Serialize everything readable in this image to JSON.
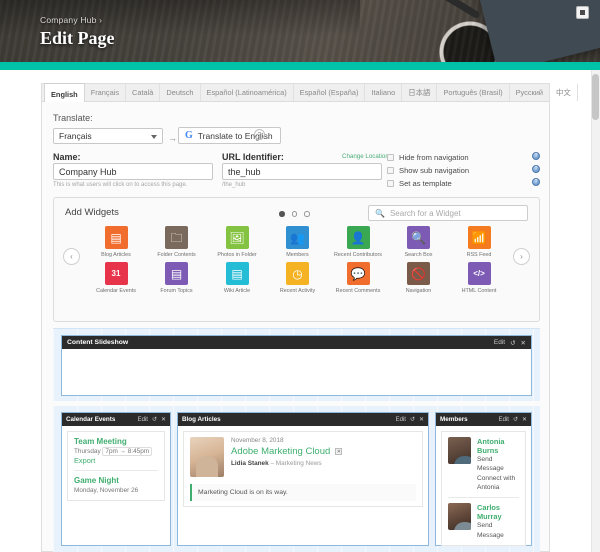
{
  "window": {
    "button_icon": "maximize-icon"
  },
  "hero": {
    "breadcrumb": "Company Hub ›",
    "title": "Edit Page",
    "accent_color": "#00c2a8"
  },
  "language_tabs": [
    {
      "label": "English",
      "active": true
    },
    {
      "label": "Français",
      "active": false
    },
    {
      "label": "Català",
      "active": false
    },
    {
      "label": "Deutsch",
      "active": false
    },
    {
      "label": "Español (Latinoamérica)",
      "active": false
    },
    {
      "label": "Español (España)",
      "active": false
    },
    {
      "label": "Italiano",
      "active": false
    },
    {
      "label": "日本語",
      "active": false
    },
    {
      "label": "Português (Brasil)",
      "active": false
    },
    {
      "label": "Русский",
      "active": false
    },
    {
      "label": "中文",
      "active": false
    }
  ],
  "translate": {
    "label": "Translate:",
    "selected_language": "Français",
    "arrow": "→",
    "button_label": "Translate to English",
    "google_glyph": "G",
    "help_glyph": "?"
  },
  "name_field": {
    "label": "Name:",
    "value": "Company Hub",
    "hint": "This is what users will click on to access this page."
  },
  "url_field": {
    "label": "URL Identifier:",
    "change_location": "Change Location",
    "value": "the_hub",
    "hint": "/the_hub"
  },
  "options": [
    {
      "label": "Hide from navigation",
      "checked": false
    },
    {
      "label": "Show sub navigation",
      "checked": false
    },
    {
      "label": "Set as template",
      "checked": false
    }
  ],
  "help_icons": [
    "?",
    "?",
    "?"
  ],
  "add_widgets": {
    "title": "Add Widgets",
    "search_placeholder": "Search for a Widget",
    "search_icon": "search-icon",
    "pages": [
      {
        "active": true
      },
      {
        "active": false
      },
      {
        "active": false
      }
    ],
    "prev_arrow": "‹",
    "next_arrow": "›",
    "rows": [
      [
        {
          "label": "Blog Articles",
          "color": "#f06d2e",
          "glyph": "▤"
        },
        {
          "label": "Folder Contents",
          "color": "#7a6a5d",
          "glyph": "🗀"
        },
        {
          "label": "Photos in Folder",
          "color": "#84c341",
          "glyph": "🖼"
        },
        {
          "label": "Members",
          "color": "#2f8fd1",
          "glyph": "👥"
        },
        {
          "label": "Recent Contributors",
          "color": "#3aa853",
          "glyph": "👤"
        },
        {
          "label": "Search Box",
          "color": "#7d5bb5",
          "glyph": "🔍"
        },
        {
          "label": "RSS Feed",
          "color": "#f47b20",
          "glyph": "📶"
        }
      ],
      [
        {
          "label": "Calendar Events",
          "color": "#e8344a",
          "glyph": "31"
        },
        {
          "label": "Forum Topics",
          "color": "#7d5bb5",
          "glyph": "▤"
        },
        {
          "label": "Wiki Article",
          "color": "#25bcd6",
          "glyph": "▤"
        },
        {
          "label": "Recent Activity",
          "color": "#f5b324",
          "glyph": "◷"
        },
        {
          "label": "Recent Comments",
          "color": "#f06d2e",
          "glyph": "💬"
        },
        {
          "label": "Navigation",
          "color": "#7a5a49",
          "glyph": "🚫"
        },
        {
          "label": "HTML Content",
          "color": "#7d5bb5",
          "glyph": "</>"
        }
      ]
    ]
  },
  "slideshow_panel": {
    "title": "Content Slideshow",
    "edit_label": "Edit",
    "revert_icon": "revert-icon",
    "close_icon": "close-icon"
  },
  "panel_tools": {
    "edit_label": "Edit",
    "revert_glyph": "↺",
    "close_glyph": "✕"
  },
  "calendar_panel": {
    "title": "Calendar Events",
    "events": [
      {
        "name": "Team Meeting",
        "day": "Thursday",
        "time": "7pm → 8:45pm",
        "action": "Export"
      },
      {
        "name": "Game Night",
        "day": "Monday, November 26",
        "time": "",
        "action": ""
      }
    ]
  },
  "blog_panel": {
    "title": "Blog Articles",
    "date": "November 8, 2018",
    "headline": "Adobe Marketing Cloud",
    "close_chip": "✕",
    "author": "Lidia Stanek",
    "category": "– Marketing News",
    "excerpt": "Marketing Cloud is on its way."
  },
  "members_panel": {
    "title": "Members",
    "members": [
      {
        "name": "Antonia Burns",
        "action1": "Send Message",
        "action2": "Connect with Antonia"
      },
      {
        "name": "Carlos Murray",
        "action1": "Send Message",
        "action2": ""
      }
    ]
  }
}
